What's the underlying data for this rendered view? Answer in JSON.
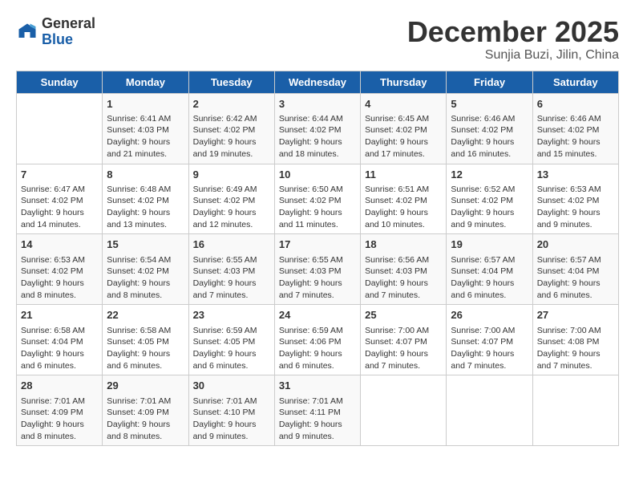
{
  "header": {
    "logo_general": "General",
    "logo_blue": "Blue",
    "month": "December 2025",
    "location": "Sunjia Buzi, Jilin, China"
  },
  "days_of_week": [
    "Sunday",
    "Monday",
    "Tuesday",
    "Wednesday",
    "Thursday",
    "Friday",
    "Saturday"
  ],
  "weeks": [
    [
      {
        "day": "",
        "content": ""
      },
      {
        "day": "1",
        "content": "Sunrise: 6:41 AM\nSunset: 4:03 PM\nDaylight: 9 hours\nand 21 minutes."
      },
      {
        "day": "2",
        "content": "Sunrise: 6:42 AM\nSunset: 4:02 PM\nDaylight: 9 hours\nand 19 minutes."
      },
      {
        "day": "3",
        "content": "Sunrise: 6:44 AM\nSunset: 4:02 PM\nDaylight: 9 hours\nand 18 minutes."
      },
      {
        "day": "4",
        "content": "Sunrise: 6:45 AM\nSunset: 4:02 PM\nDaylight: 9 hours\nand 17 minutes."
      },
      {
        "day": "5",
        "content": "Sunrise: 6:46 AM\nSunset: 4:02 PM\nDaylight: 9 hours\nand 16 minutes."
      },
      {
        "day": "6",
        "content": "Sunrise: 6:46 AM\nSunset: 4:02 PM\nDaylight: 9 hours\nand 15 minutes."
      }
    ],
    [
      {
        "day": "7",
        "content": "Sunrise: 6:47 AM\nSunset: 4:02 PM\nDaylight: 9 hours\nand 14 minutes."
      },
      {
        "day": "8",
        "content": "Sunrise: 6:48 AM\nSunset: 4:02 PM\nDaylight: 9 hours\nand 13 minutes."
      },
      {
        "day": "9",
        "content": "Sunrise: 6:49 AM\nSunset: 4:02 PM\nDaylight: 9 hours\nand 12 minutes."
      },
      {
        "day": "10",
        "content": "Sunrise: 6:50 AM\nSunset: 4:02 PM\nDaylight: 9 hours\nand 11 minutes."
      },
      {
        "day": "11",
        "content": "Sunrise: 6:51 AM\nSunset: 4:02 PM\nDaylight: 9 hours\nand 10 minutes."
      },
      {
        "day": "12",
        "content": "Sunrise: 6:52 AM\nSunset: 4:02 PM\nDaylight: 9 hours\nand 9 minutes."
      },
      {
        "day": "13",
        "content": "Sunrise: 6:53 AM\nSunset: 4:02 PM\nDaylight: 9 hours\nand 9 minutes."
      }
    ],
    [
      {
        "day": "14",
        "content": "Sunrise: 6:53 AM\nSunset: 4:02 PM\nDaylight: 9 hours\nand 8 minutes."
      },
      {
        "day": "15",
        "content": "Sunrise: 6:54 AM\nSunset: 4:02 PM\nDaylight: 9 hours\nand 8 minutes."
      },
      {
        "day": "16",
        "content": "Sunrise: 6:55 AM\nSunset: 4:03 PM\nDaylight: 9 hours\nand 7 minutes."
      },
      {
        "day": "17",
        "content": "Sunrise: 6:55 AM\nSunset: 4:03 PM\nDaylight: 9 hours\nand 7 minutes."
      },
      {
        "day": "18",
        "content": "Sunrise: 6:56 AM\nSunset: 4:03 PM\nDaylight: 9 hours\nand 7 minutes."
      },
      {
        "day": "19",
        "content": "Sunrise: 6:57 AM\nSunset: 4:04 PM\nDaylight: 9 hours\nand 6 minutes."
      },
      {
        "day": "20",
        "content": "Sunrise: 6:57 AM\nSunset: 4:04 PM\nDaylight: 9 hours\nand 6 minutes."
      }
    ],
    [
      {
        "day": "21",
        "content": "Sunrise: 6:58 AM\nSunset: 4:04 PM\nDaylight: 9 hours\nand 6 minutes."
      },
      {
        "day": "22",
        "content": "Sunrise: 6:58 AM\nSunset: 4:05 PM\nDaylight: 9 hours\nand 6 minutes."
      },
      {
        "day": "23",
        "content": "Sunrise: 6:59 AM\nSunset: 4:05 PM\nDaylight: 9 hours\nand 6 minutes."
      },
      {
        "day": "24",
        "content": "Sunrise: 6:59 AM\nSunset: 4:06 PM\nDaylight: 9 hours\nand 6 minutes."
      },
      {
        "day": "25",
        "content": "Sunrise: 7:00 AM\nSunset: 4:07 PM\nDaylight: 9 hours\nand 7 minutes."
      },
      {
        "day": "26",
        "content": "Sunrise: 7:00 AM\nSunset: 4:07 PM\nDaylight: 9 hours\nand 7 minutes."
      },
      {
        "day": "27",
        "content": "Sunrise: 7:00 AM\nSunset: 4:08 PM\nDaylight: 9 hours\nand 7 minutes."
      }
    ],
    [
      {
        "day": "28",
        "content": "Sunrise: 7:01 AM\nSunset: 4:09 PM\nDaylight: 9 hours\nand 8 minutes."
      },
      {
        "day": "29",
        "content": "Sunrise: 7:01 AM\nSunset: 4:09 PM\nDaylight: 9 hours\nand 8 minutes."
      },
      {
        "day": "30",
        "content": "Sunrise: 7:01 AM\nSunset: 4:10 PM\nDaylight: 9 hours\nand 9 minutes."
      },
      {
        "day": "31",
        "content": "Sunrise: 7:01 AM\nSunset: 4:11 PM\nDaylight: 9 hours\nand 9 minutes."
      },
      {
        "day": "",
        "content": ""
      },
      {
        "day": "",
        "content": ""
      },
      {
        "day": "",
        "content": ""
      }
    ]
  ]
}
